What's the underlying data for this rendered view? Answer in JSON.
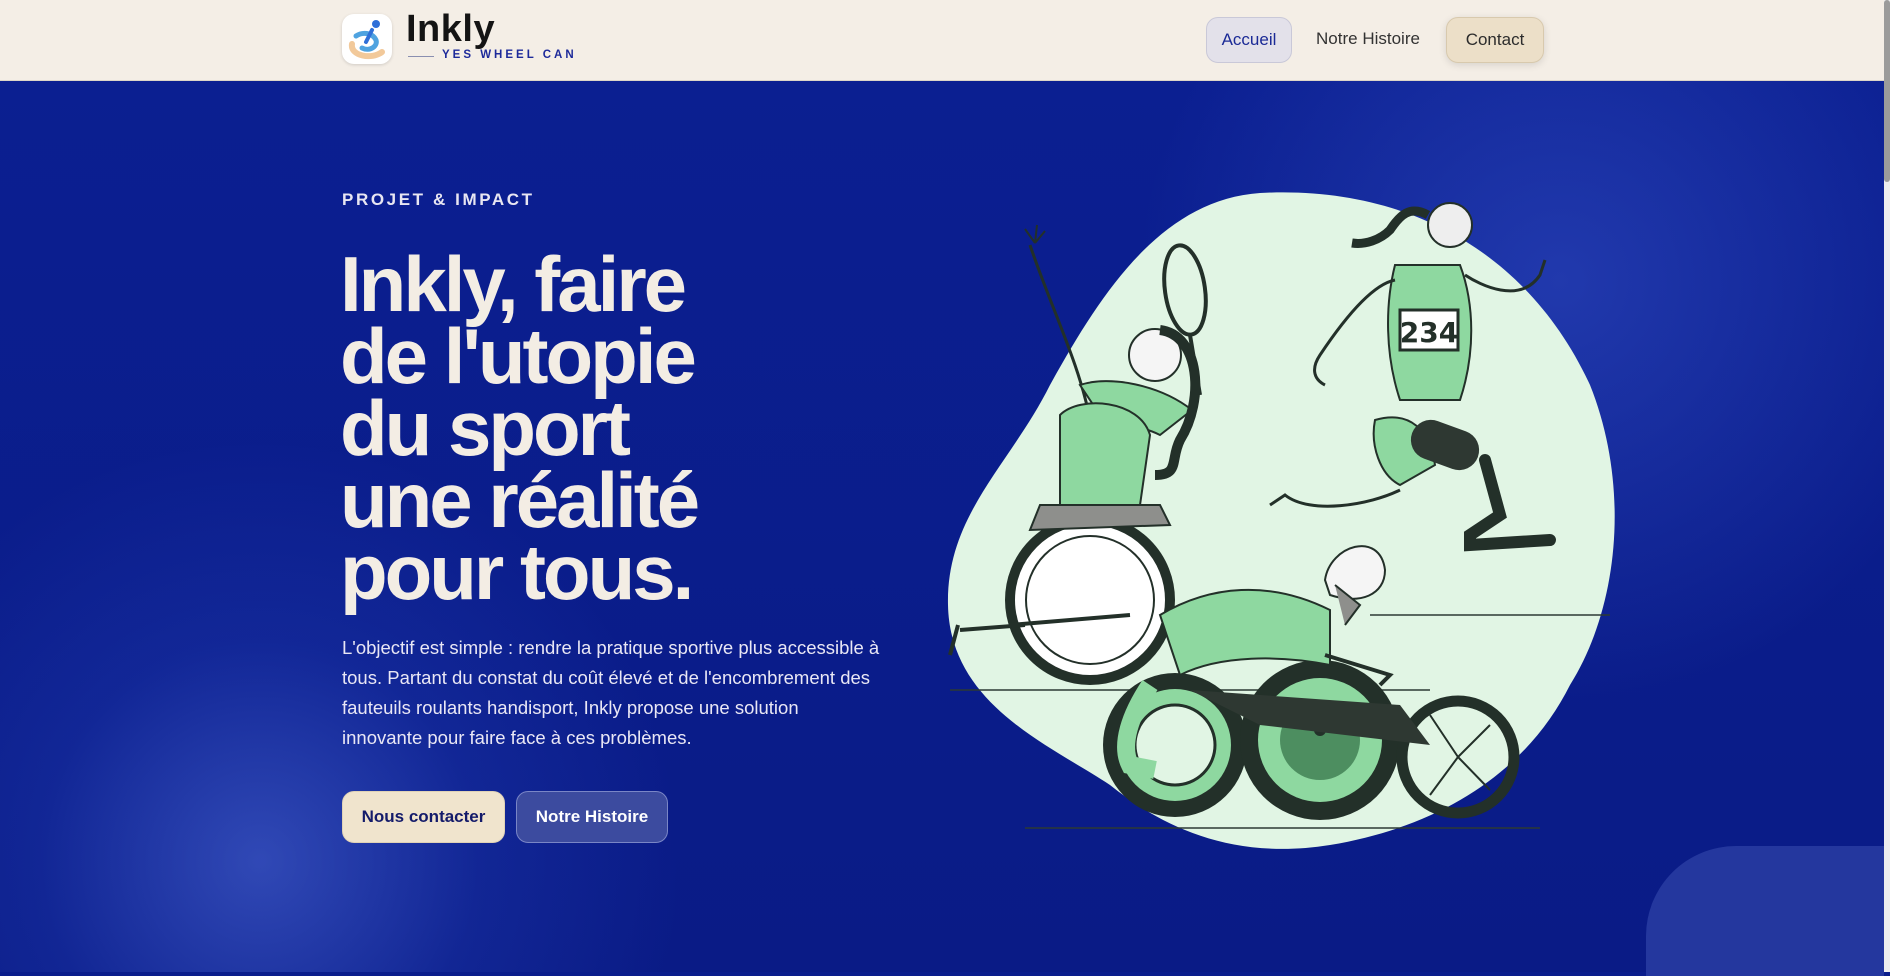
{
  "header": {
    "logo_name": "Inkly",
    "tagline": "YES WHEEL CAN",
    "nav": [
      "Accueil",
      "Notre Histoire",
      "Contact"
    ]
  },
  "hero": {
    "eyebrow": "PROJET & IMPACT",
    "headline": [
      "Inkly, faire",
      "de l'utopie",
      "du sport",
      "une réalité",
      "pour tous."
    ],
    "intro": "L'objectif est simple : rendre la pratique sportive plus accessible à tous. Partant du constat du coût élevé et de l'encombrement des fauteuils roulants handisport, Inkly propose une solution innovante pour faire face à ces problèmes.",
    "cta_primary": "Nous contacter",
    "cta_secondary": "Notre Histoire",
    "bib_number": "234"
  },
  "colors": {
    "header_bg": "#f4eee6",
    "hero_bg": "#0a1d8c",
    "accent_cream": "#f0e4cd",
    "headline_text": "#f3ede4",
    "athlete_green": "#8ed8a0",
    "blob_mint": "#e1f5e4"
  },
  "icons": [
    "logo-icon",
    "athletes-illustration"
  ]
}
